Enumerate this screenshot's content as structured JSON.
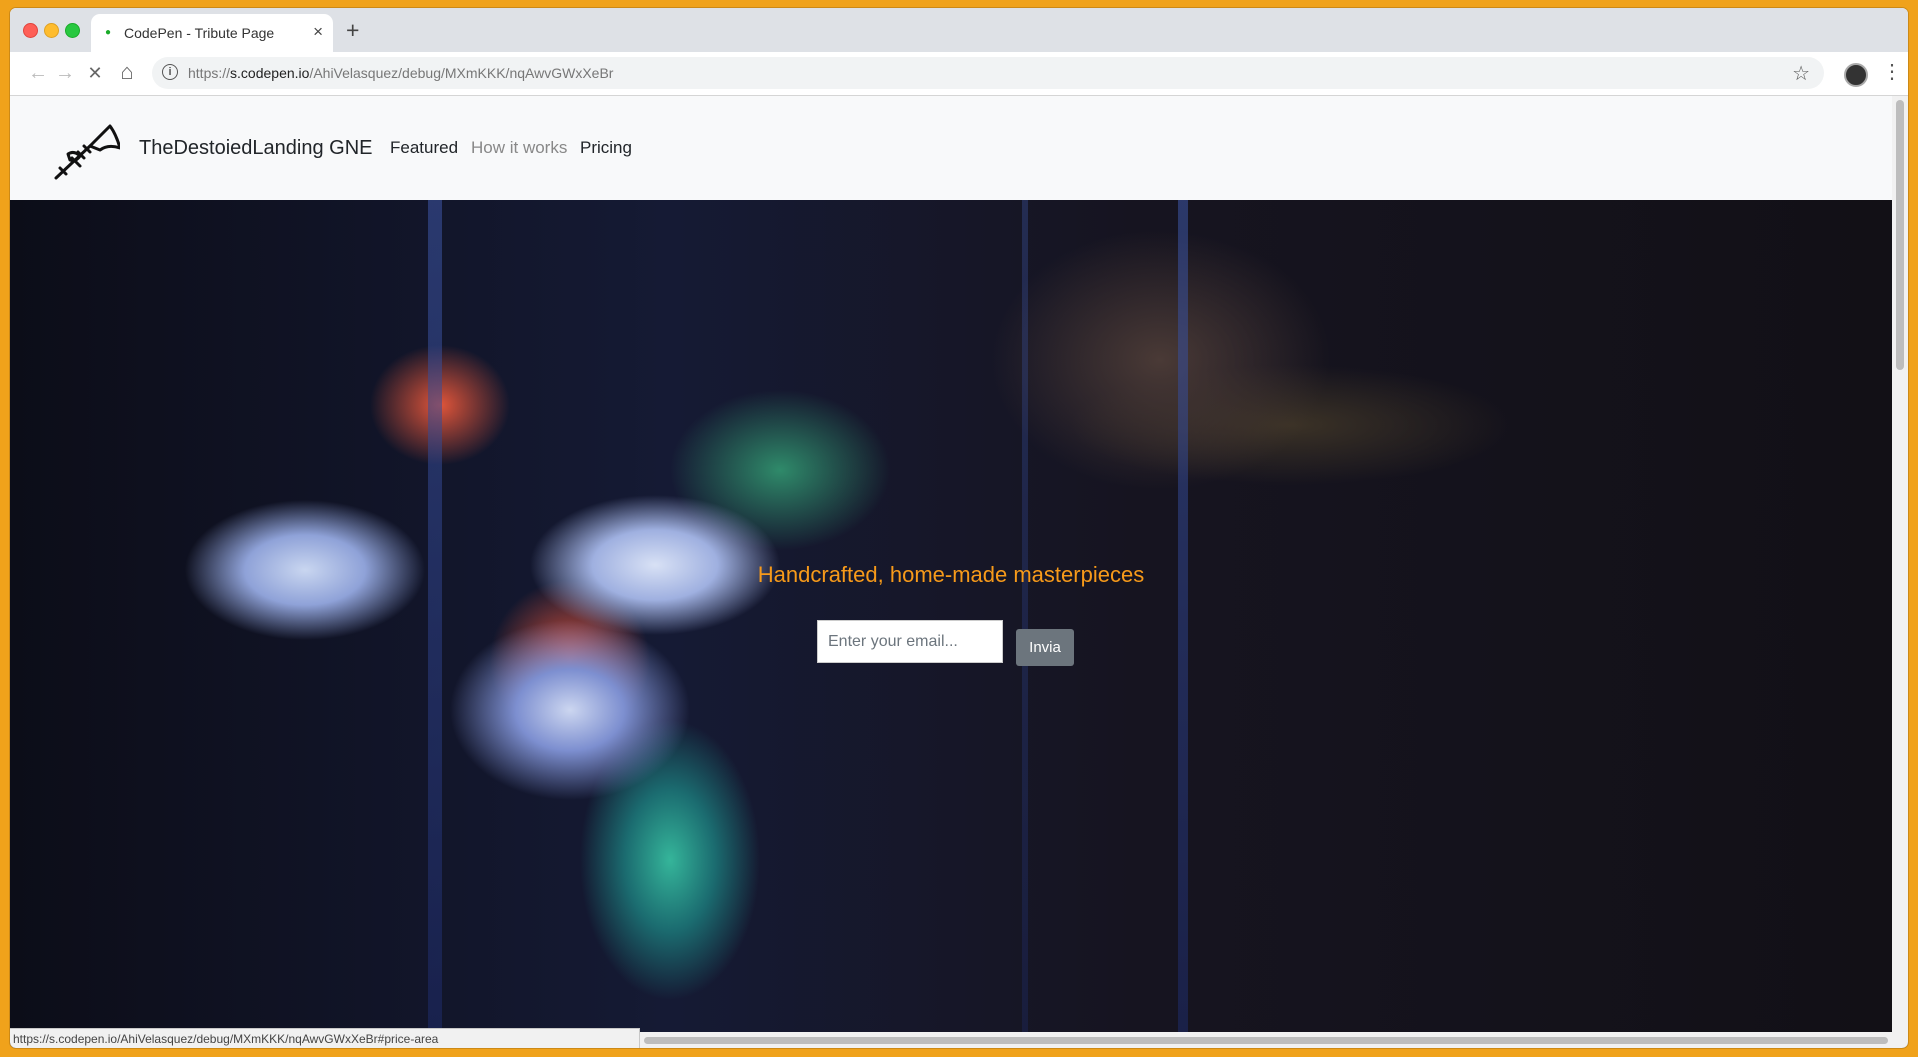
{
  "browser": {
    "tab_title": "CodePen - Tribute Page",
    "tab_close": "×",
    "new_tab": "+",
    "url_scheme": "https://",
    "url_host": "s.codepen.io",
    "url_path": "/AhiVelasquez/debug/MXmKKK/nqAwvGWxXeBr",
    "back_icon": "←",
    "forward_icon": "→",
    "reload_icon": "✕",
    "home_icon": "⌂",
    "info_icon": "i",
    "star_icon": "☆",
    "menu_icon": "⋮",
    "status_url": "https://s.codepen.io/AhiVelasquez/debug/MXmKKK/nqAwvGWxXeBr#price-area"
  },
  "navbar": {
    "brand": "TheDestoiedLanding GNE",
    "links": [
      {
        "label": "Featured",
        "state": "active"
      },
      {
        "label": "How it works",
        "state": "muted"
      },
      {
        "label": "Pricing",
        "state": "normal"
      }
    ]
  },
  "hero": {
    "title": "Handcrafted, home-made masterpieces",
    "email_placeholder": "Enter your email...",
    "submit_label": "Invia"
  },
  "colors": {
    "window_background": "#f0a21b",
    "hero_title": "#f79a1a",
    "button": "#6c757d",
    "navbar": "#f8f9fa"
  }
}
